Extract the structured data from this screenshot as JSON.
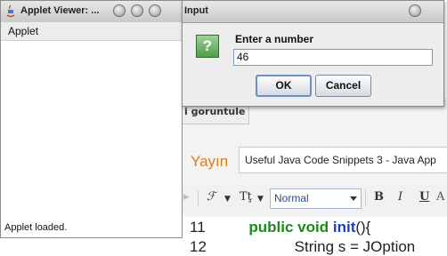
{
  "applet_viewer": {
    "title": "Applet Viewer: ...",
    "menu_label": "Applet",
    "status": "Applet loaded."
  },
  "dialog": {
    "title": "Input",
    "icon_glyph": "?",
    "prompt": "Enter a number",
    "input_value": "46",
    "ok_label": "OK",
    "cancel_label": "Cancel"
  },
  "background": {
    "tab_label": "i goruntule",
    "publish_label": "Yayın",
    "post_title": "Useful Java Code Snippets 3 - Java App",
    "format_select": "Normal",
    "toolbar": {
      "font_glyph": "ℱ",
      "size_glyph": "Tţ",
      "bold": "B",
      "italic": "I",
      "underline": "U"
    },
    "code": {
      "line11_num": "11",
      "line11_kw": "public void",
      "line11_fn": "init",
      "line11_rest": "(){",
      "line12_num": "12",
      "line12_text": "String s = JOption"
    }
  },
  "colors": {
    "accent_orange": "#e07b1e",
    "keyword_green": "#1a8a1a",
    "method_blue": "#1d3fb8"
  }
}
